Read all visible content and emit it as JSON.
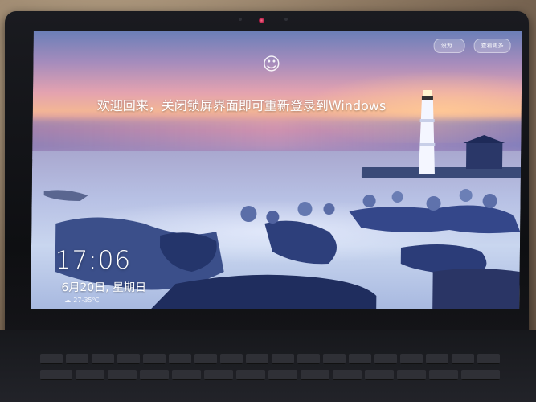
{
  "lock_screen": {
    "welcome_message": "欢迎回来，关闭锁屏界面即可重新登录到Windows",
    "time": "17:06",
    "date": "6月20日, 星期日",
    "weather": "27-35℃",
    "top_buttons": [
      "设为...",
      "查看更多"
    ]
  },
  "icons": {
    "smiley": "smiley-icon",
    "weather": "cloud-icon"
  }
}
